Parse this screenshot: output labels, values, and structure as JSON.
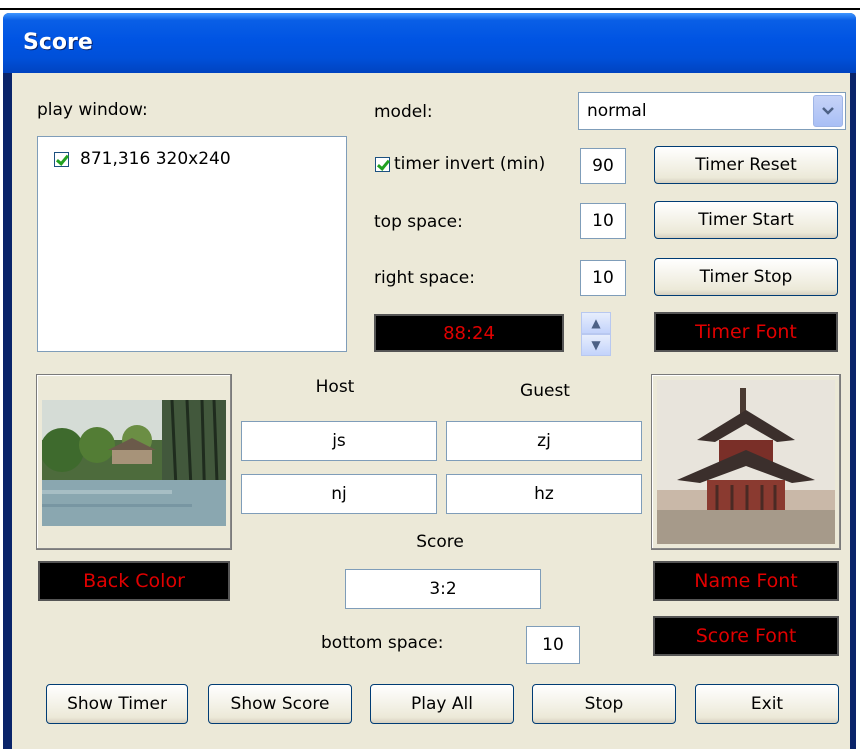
{
  "window": {
    "title": "Score"
  },
  "play_window": {
    "label": "play window:",
    "items": [
      {
        "checked": true,
        "label": "871,316 320x240"
      }
    ]
  },
  "model": {
    "label": "model:",
    "value": "normal"
  },
  "timer_invert": {
    "checked": true,
    "label": "timer invert (min)",
    "value": "90"
  },
  "top_space": {
    "label": "top space:",
    "value": "10"
  },
  "right_space": {
    "label": "right space:",
    "value": "10"
  },
  "timer_display": "88:24",
  "buttons": {
    "timer_reset": "Timer Reset",
    "timer_start": "Timer Start",
    "timer_stop": "Timer Stop",
    "timer_font": "Timer Font",
    "back_color": "Back Color",
    "name_font": "Name Font",
    "score_font": "Score Font",
    "show_timer": "Show Timer",
    "show_score": "Show Score",
    "play_all": "Play All",
    "stop": "Stop",
    "exit": "Exit"
  },
  "teams": {
    "host_label": "Host",
    "guest_label": "Guest",
    "host_name_1": "js",
    "guest_name_1": "zj",
    "host_name_2": "nj",
    "guest_name_2": "hz"
  },
  "score": {
    "label": "Score",
    "value": "3:2"
  },
  "bottom_space": {
    "label": "bottom space:",
    "value": "10"
  },
  "colors": {
    "title_bar": "#0054e3",
    "dialog_bg": "#ece9d8",
    "font_button_text": "#e00000",
    "font_button_bg": "#000000"
  },
  "icons": {
    "dropdown": "chevron-down-icon",
    "spin_up": "spin-up-icon",
    "spin_down": "spin-down-icon",
    "check": "check-icon"
  }
}
